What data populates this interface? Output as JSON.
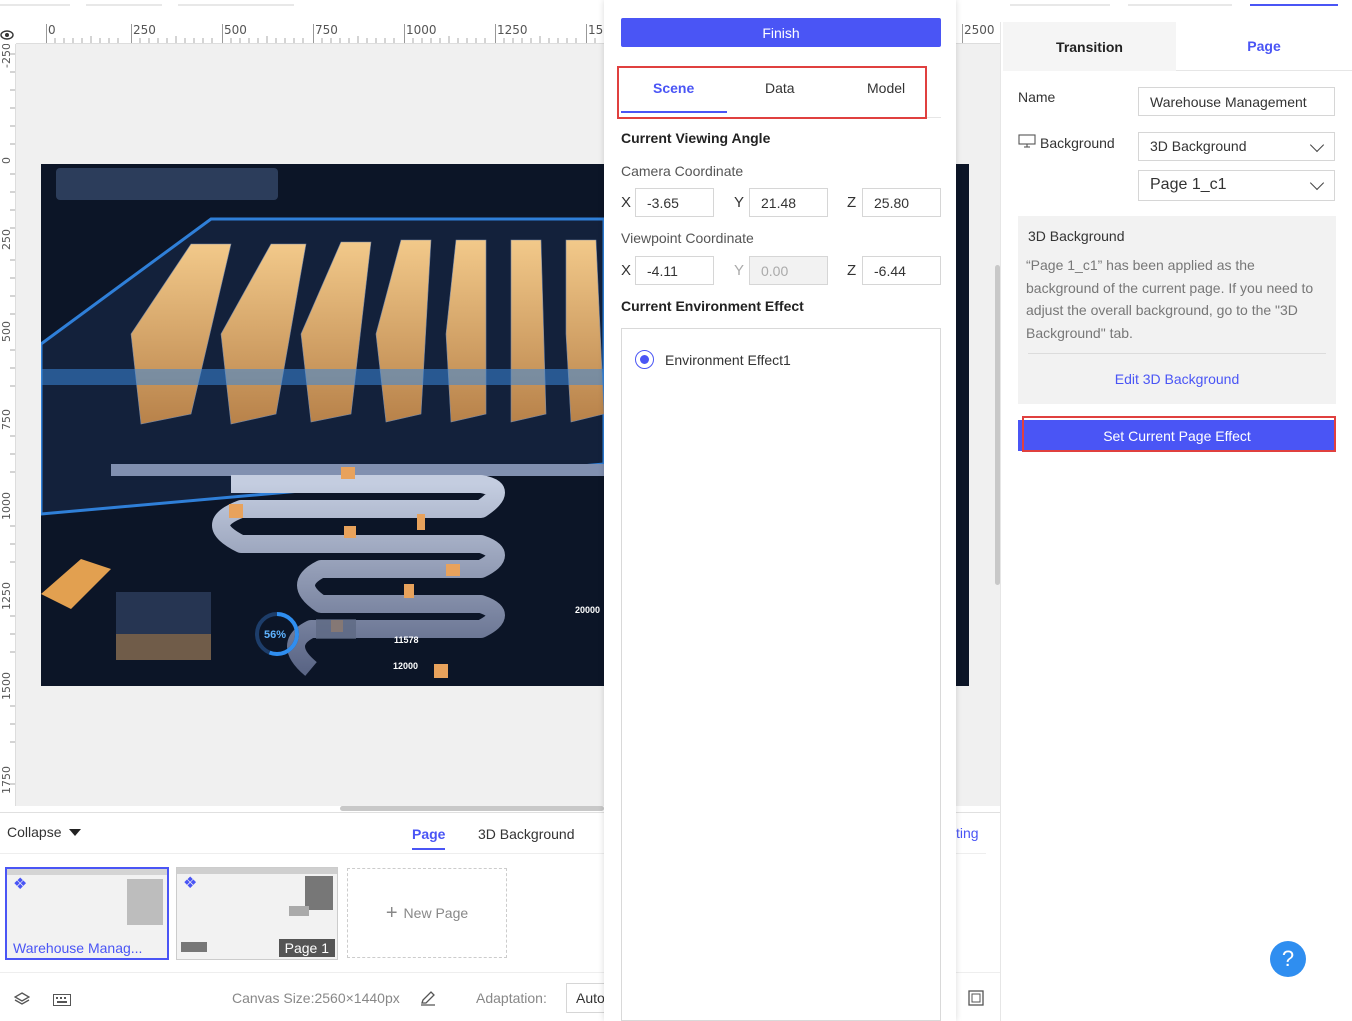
{
  "ruler": {
    "h_labels": [
      "0",
      "250",
      "500",
      "750",
      "1000",
      "1250",
      "15",
      "2500"
    ],
    "v_labels": [
      "-250",
      "0",
      "250",
      "500",
      "750",
      "1000",
      "1250",
      "1500",
      "1750"
    ]
  },
  "scene": {
    "gauge_percent": "56%",
    "gauge_value": 0.56,
    "label_20000": "20000",
    "label_11578": "11578",
    "label_12000": "12000"
  },
  "bottom_panel": {
    "collapse_label": "Collapse",
    "tabs": [
      "Page",
      "3D Background"
    ],
    "tab_partial": "ting",
    "pages": [
      {
        "title": "Warehouse Manag..."
      },
      {
        "title": "Page 1"
      }
    ],
    "new_page_label": "New Page"
  },
  "statusbar": {
    "canvas_size": "Canvas Size:2560×1440px",
    "adaptation_label": "Adaptation:",
    "adaptation_value": "Auto"
  },
  "middle_panel": {
    "finish_label": "Finish",
    "tabs": [
      "Scene",
      "Data",
      "Model"
    ],
    "active_tab": "Scene",
    "viewing_angle_title": "Current Viewing Angle",
    "camera_label": "Camera Coordinate",
    "camera": {
      "x": "-3.65",
      "y": "21.48",
      "z": "25.80"
    },
    "viewpoint_label": "Viewpoint Coordinate",
    "viewpoint": {
      "x": "-4.11",
      "y": "0.00",
      "z": "-6.44"
    },
    "axis_x": "X",
    "axis_y": "Y",
    "axis_z": "Z",
    "env_title": "Current Environment Effect",
    "env_option": "Environment Effect1"
  },
  "right_panel": {
    "tabs": [
      "Transition",
      "Page"
    ],
    "active_tab": "Page",
    "name_label": "Name",
    "name_value": "Warehouse Management",
    "background_label": "Background",
    "background_value": "3D Background",
    "background_page": "Page 1_c1",
    "info_title": "3D Background",
    "info_text": "“Page 1_c1” has been applied as the background of the current page. If you need to adjust the overall background, go to the \"3D Background\" tab.",
    "edit_link": "Edit 3D Background",
    "set_effect_label": "Set Current Page Effect",
    "help_label": "?"
  },
  "colors": {
    "accent": "#4a55f5",
    "highlight_box": "#e0403f",
    "help_button": "#2f8ef0",
    "scene_bg": "#0c1527"
  }
}
